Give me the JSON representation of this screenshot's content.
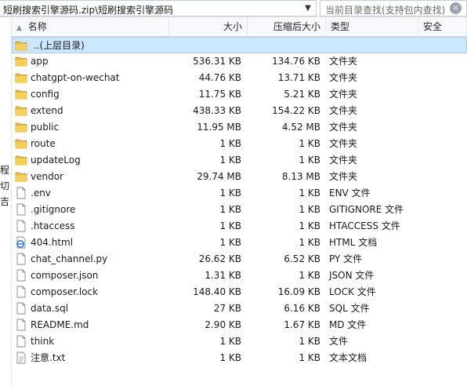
{
  "address": {
    "path": "短刷搜索引擎源码.zip\\短刷搜索引擎源码",
    "search_placeholder": "当前目录查找(支持包内查找)"
  },
  "left_strip": [
    "程",
    "切",
    "吉"
  ],
  "columns": {
    "name": "名称",
    "size": "大小",
    "compressed": "压缩后大小",
    "type": "类型",
    "security": "安全"
  },
  "parent_row": {
    "label": "..(上层目录)"
  },
  "files": [
    {
      "name": "app",
      "size": "536.31 KB",
      "compressed": "134.76 KB",
      "type": "文件夹",
      "icon": "folder-icon"
    },
    {
      "name": "chatgpt-on-wechat",
      "size": "44.76 KB",
      "compressed": "13.71 KB",
      "type": "文件夹",
      "icon": "folder-icon"
    },
    {
      "name": "config",
      "size": "11.75 KB",
      "compressed": "5.21 KB",
      "type": "文件夹",
      "icon": "folder-icon"
    },
    {
      "name": "extend",
      "size": "438.33 KB",
      "compressed": "154.22 KB",
      "type": "文件夹",
      "icon": "folder-icon"
    },
    {
      "name": "public",
      "size": "11.95 MB",
      "compressed": "4.52 MB",
      "type": "文件夹",
      "icon": "folder-icon"
    },
    {
      "name": "route",
      "size": "1 KB",
      "compressed": "1 KB",
      "type": "文件夹",
      "icon": "folder-icon"
    },
    {
      "name": "updateLog",
      "size": "1 KB",
      "compressed": "1 KB",
      "type": "文件夹",
      "icon": "folder-icon"
    },
    {
      "name": "vendor",
      "size": "29.74 MB",
      "compressed": "8.13 MB",
      "type": "文件夹",
      "icon": "folder-icon"
    },
    {
      "name": ".env",
      "size": "1 KB",
      "compressed": "1 KB",
      "type": "ENV 文件",
      "icon": "file-icon"
    },
    {
      "name": ".gitignore",
      "size": "1 KB",
      "compressed": "1 KB",
      "type": "GITIGNORE 文件",
      "icon": "file-icon"
    },
    {
      "name": ".htaccess",
      "size": "1 KB",
      "compressed": "1 KB",
      "type": "HTACCESS 文件",
      "icon": "file-icon"
    },
    {
      "name": "404.html",
      "size": "1 KB",
      "compressed": "1 KB",
      "type": "HTML 文档",
      "icon": "html-file-icon"
    },
    {
      "name": "chat_channel.py",
      "size": "26.62 KB",
      "compressed": "6.52 KB",
      "type": "PY 文件",
      "icon": "file-icon"
    },
    {
      "name": "composer.json",
      "size": "1.31 KB",
      "compressed": "1 KB",
      "type": "JSON 文件",
      "icon": "file-icon"
    },
    {
      "name": "composer.lock",
      "size": "148.40 KB",
      "compressed": "16.09 KB",
      "type": "LOCK 文件",
      "icon": "file-icon"
    },
    {
      "name": "data.sql",
      "size": "27 KB",
      "compressed": "6.16 KB",
      "type": "SQL 文件",
      "icon": "file-icon"
    },
    {
      "name": "README.md",
      "size": "2.90 KB",
      "compressed": "1.67 KB",
      "type": "MD 文件",
      "icon": "file-icon"
    },
    {
      "name": "think",
      "size": "1 KB",
      "compressed": "1 KB",
      "type": "文件",
      "icon": "file-icon"
    },
    {
      "name": "注意.txt",
      "size": "1 KB",
      "compressed": "1 KB",
      "type": "文本文档",
      "icon": "text-file-icon"
    }
  ],
  "colors": {
    "folder": "#e8b93f",
    "selection": "#cce8ff",
    "header_bg": "#f7f9fc"
  }
}
